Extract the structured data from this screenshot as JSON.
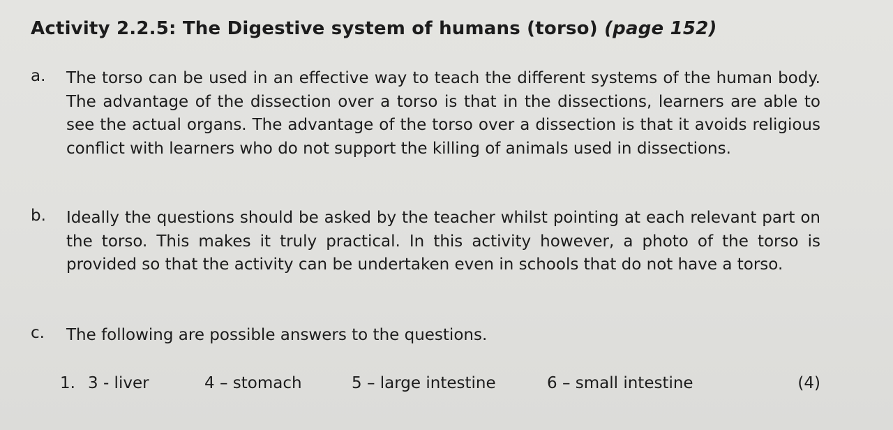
{
  "title": {
    "main": "Activity 2.2.5: The Digestive system of humans (torso)",
    "page_ref": "(page 152)"
  },
  "items": [
    {
      "letter": "a.",
      "text": "The torso can be used in an effective way to teach the different systems of the human body. The advantage of the dissection over a torso is that in the dissections, learners are able to see the actual organs. The advantage of the torso over a dissection is that it avoids religious conflict with learners who do not support the killing of animals used in dissections."
    },
    {
      "letter": "b.",
      "text": "Ideally the questions should be asked by the teacher whilst pointing at each relevant part on the torso. This makes it truly practical. In this activity however, a photo of the torso is provided so that the activity can be undertaken even in schools that do not have a torso."
    },
    {
      "letter": "c.",
      "text": "The following are possible answers to the questions."
    }
  ],
  "answers": {
    "number": "1.",
    "list": [
      "3 - liver",
      "4 – stomach",
      "5 – large intestine",
      "6 – small intestine"
    ],
    "marks": "(4)"
  }
}
